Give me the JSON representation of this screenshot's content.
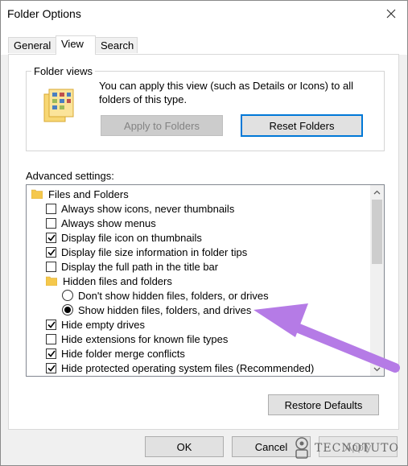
{
  "window": {
    "title": "Folder Options"
  },
  "tabs": [
    {
      "label": "General"
    },
    {
      "label": "View"
    },
    {
      "label": "Search"
    }
  ],
  "folder_views": {
    "legend": "Folder views",
    "description": "You can apply this view (such as Details or Icons) to all folders of this type.",
    "apply_label": "Apply to Folders",
    "reset_label": "Reset Folders"
  },
  "advanced": {
    "label": "Advanced settings:",
    "items": [
      {
        "type": "folder",
        "label": "Files and Folders"
      },
      {
        "type": "checkbox",
        "checked": false,
        "label": "Always show icons, never thumbnails"
      },
      {
        "type": "checkbox",
        "checked": false,
        "label": "Always show menus"
      },
      {
        "type": "checkbox",
        "checked": true,
        "label": "Display file icon on thumbnails"
      },
      {
        "type": "checkbox",
        "checked": true,
        "label": "Display file size information in folder tips"
      },
      {
        "type": "checkbox",
        "checked": false,
        "label": "Display the full path in the title bar"
      },
      {
        "type": "folder",
        "label": "Hidden files and folders"
      },
      {
        "type": "radio",
        "selected": false,
        "label": "Don't show hidden files, folders, or drives"
      },
      {
        "type": "radio",
        "selected": true,
        "label": "Show hidden files, folders, and drives"
      },
      {
        "type": "checkbox",
        "checked": true,
        "label": "Hide empty drives"
      },
      {
        "type": "checkbox",
        "checked": false,
        "label": "Hide extensions for known file types"
      },
      {
        "type": "checkbox",
        "checked": true,
        "label": "Hide folder merge conflicts"
      },
      {
        "type": "checkbox",
        "checked": true,
        "label": "Hide protected operating system files (Recommended)"
      }
    ]
  },
  "buttons": {
    "restore": "Restore Defaults",
    "ok": "OK",
    "cancel": "Cancel",
    "apply": "Apply"
  },
  "watermark": "TECNOTUTO",
  "colors": {
    "accent": "#0078d7",
    "annotation_arrow": "#b57be6",
    "folder": "#f5c84c"
  }
}
